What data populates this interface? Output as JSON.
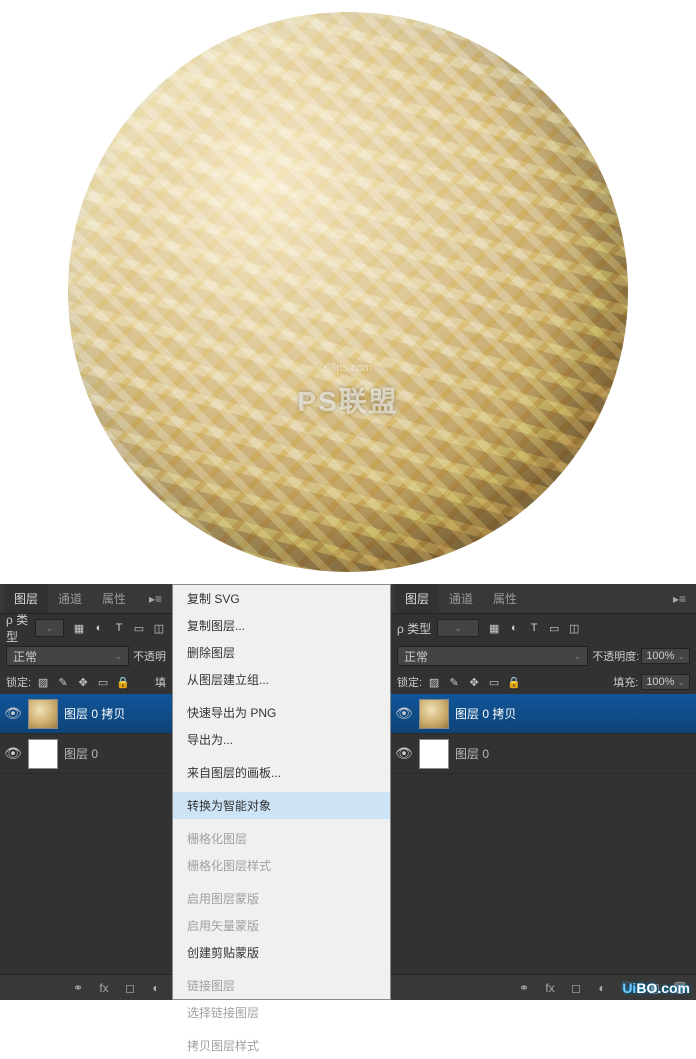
{
  "watermark": {
    "main": "PS联盟",
    "sub": "68ps.com"
  },
  "panel": {
    "tabs": {
      "layers": "图层",
      "channels": "通道",
      "properties": "属性"
    },
    "filter": {
      "label": "ρ 类型"
    },
    "blend": {
      "mode": "正常",
      "opacity_label": "不透明",
      "opacity_label_full": "不透明度:",
      "opacity_value": "100%"
    },
    "lock": {
      "label": "锁定:",
      "fill_short": "填",
      "fill_label": "填充:",
      "fill_value": "100%"
    },
    "layers_list_left": [
      {
        "name": "图层 0 拷贝",
        "selected": true,
        "thumb": "gold"
      },
      {
        "name": "图层 0",
        "selected": false,
        "thumb": "white"
      }
    ],
    "layers_list_right": [
      {
        "name": "图层 0 拷贝",
        "selected": true,
        "thumb": "gold"
      },
      {
        "name": "图层 0",
        "selected": false,
        "thumb": "white"
      }
    ]
  },
  "context_menu": [
    {
      "label": "复制 SVG",
      "type": "item"
    },
    {
      "label": "复制图层...",
      "type": "item"
    },
    {
      "label": "删除图层",
      "type": "item"
    },
    {
      "label": "从图层建立组...",
      "type": "item"
    },
    {
      "type": "sep"
    },
    {
      "label": "快速导出为 PNG",
      "type": "item"
    },
    {
      "label": "导出为...",
      "type": "item"
    },
    {
      "type": "sep"
    },
    {
      "label": "来自图层的画板...",
      "type": "item"
    },
    {
      "type": "sep"
    },
    {
      "label": "转换为智能对象",
      "type": "item",
      "highlight": true
    },
    {
      "type": "sep"
    },
    {
      "label": "栅格化图层",
      "type": "disabled"
    },
    {
      "label": "栅格化图层样式",
      "type": "disabled"
    },
    {
      "type": "sep"
    },
    {
      "label": "启用图层蒙版",
      "type": "disabled"
    },
    {
      "label": "启用矢量蒙版",
      "type": "disabled"
    },
    {
      "label": "创建剪贴蒙版",
      "type": "item"
    },
    {
      "type": "sep"
    },
    {
      "label": "链接图层",
      "type": "disabled"
    },
    {
      "label": "选择链接图层",
      "type": "disabled"
    },
    {
      "type": "sep"
    },
    {
      "label": "拷贝图层样式",
      "type": "disabled"
    }
  ],
  "footer_watermark": {
    "prefix": "Ui",
    "suffix": "BO.com"
  }
}
